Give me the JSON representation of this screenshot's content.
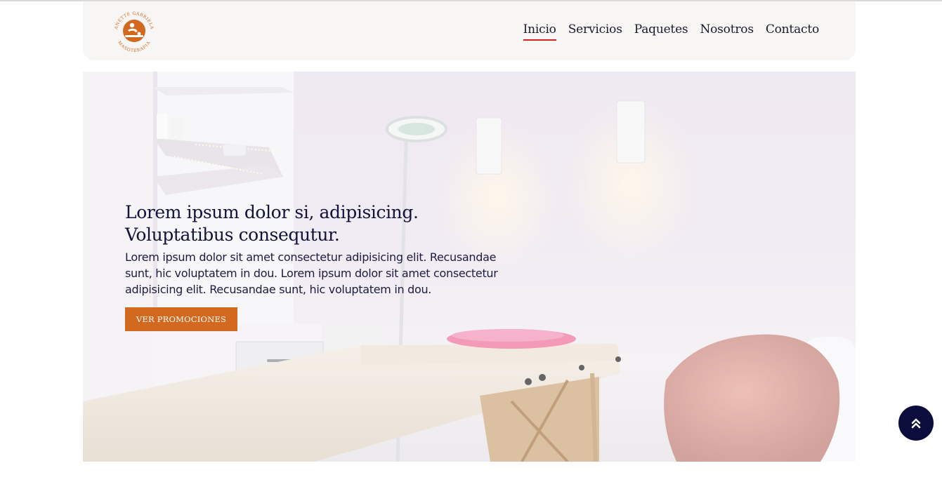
{
  "brand": {
    "logo_ring_text": "ANETTE GABRIELA",
    "logo_subtitle": "MASOTERAPIA",
    "logo_color": "#d2691e",
    "logo_icon": "massage-person-icon"
  },
  "nav": {
    "items": [
      {
        "label": "Inicio",
        "active": true
      },
      {
        "label": "Servicios",
        "active": false
      },
      {
        "label": "Paquetes",
        "active": false
      },
      {
        "label": "Nosotros",
        "active": false
      },
      {
        "label": "Contacto",
        "active": false
      }
    ],
    "active_underline_color": "#d42222"
  },
  "hero": {
    "title_line1": "Lorem ipsum dolor si, adipisicing.",
    "title_line2": "Voluptatibus consequtur.",
    "text_line1": "Lorem ipsum dolor sit amet consectetur adipisicing elit. Recusandae",
    "text_line2": "sunt, hic voluptatem in dou. Lorem ipsum dolor sit amet consectetur",
    "text_line3": "adipisicing elit. Recusandae sunt, hic voluptatem in dou.",
    "button_label": "VER PROMOCIONES",
    "button_color": "#d2691e"
  },
  "scroll_top": {
    "icon": "double-chevron-up-icon",
    "color": "#0d0d3d"
  }
}
